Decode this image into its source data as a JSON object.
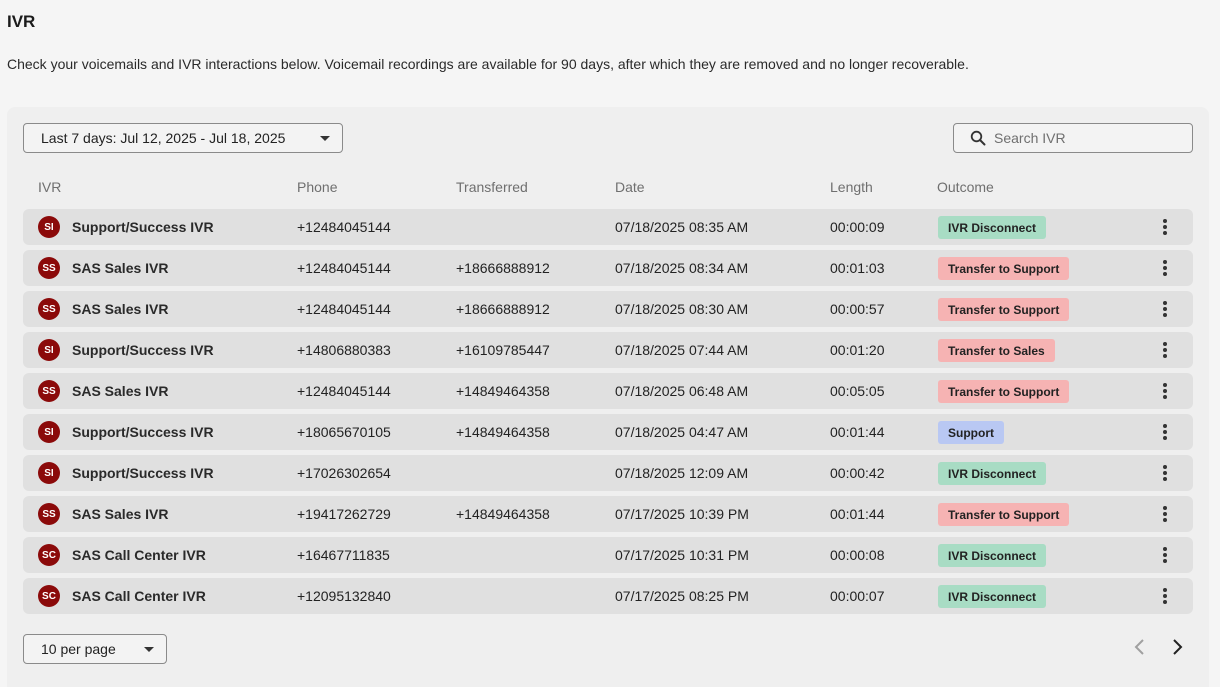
{
  "page": {
    "title": "IVR",
    "description": "Check your voicemails and IVR interactions below. Voicemail recordings are available for 90 days, after which they are removed and no longer recoverable."
  },
  "filters": {
    "date_range": "Last 7 days: Jul 12, 2025 - Jul 18, 2025",
    "search_placeholder": "Search IVR"
  },
  "columns": {
    "ivr": "IVR",
    "phone": "Phone",
    "transferred": "Transferred",
    "date": "Date",
    "length": "Length",
    "outcome": "Outcome"
  },
  "colors": {
    "avatar": "#8b0a0a",
    "ivr_disconnect": "#a8dcc4",
    "transfer": "#f6b3b3",
    "support": "#b9c8f3"
  },
  "rows": [
    {
      "initials": "SI",
      "ivr": "Support/Success IVR",
      "phone": "+12484045144",
      "transferred": "",
      "date": "07/18/2025 08:35 AM",
      "length": "00:00:09",
      "outcome": "IVR Disconnect",
      "outcome_color": "#a8dcc4"
    },
    {
      "initials": "SS",
      "ivr": "SAS Sales IVR",
      "phone": "+12484045144",
      "transferred": "+18666888912",
      "date": "07/18/2025 08:34 AM",
      "length": "00:01:03",
      "outcome": "Transfer to Support",
      "outcome_color": "#f6b3b3"
    },
    {
      "initials": "SS",
      "ivr": "SAS Sales IVR",
      "phone": "+12484045144",
      "transferred": "+18666888912",
      "date": "07/18/2025 08:30 AM",
      "length": "00:00:57",
      "outcome": "Transfer to Support",
      "outcome_color": "#f6b3b3"
    },
    {
      "initials": "SI",
      "ivr": "Support/Success IVR",
      "phone": "+14806880383",
      "transferred": "+16109785447",
      "date": "07/18/2025 07:44 AM",
      "length": "00:01:20",
      "outcome": "Transfer to Sales",
      "outcome_color": "#f6b3b3"
    },
    {
      "initials": "SS",
      "ivr": "SAS Sales IVR",
      "phone": "+12484045144",
      "transferred": "+14849464358",
      "date": "07/18/2025 06:48 AM",
      "length": "00:05:05",
      "outcome": "Transfer to Support",
      "outcome_color": "#f6b3b3"
    },
    {
      "initials": "SI",
      "ivr": "Support/Success IVR",
      "phone": "+18065670105",
      "transferred": "+14849464358",
      "date": "07/18/2025 04:47 AM",
      "length": "00:01:44",
      "outcome": "Support",
      "outcome_color": "#b9c8f3"
    },
    {
      "initials": "SI",
      "ivr": "Support/Success IVR",
      "phone": "+17026302654",
      "transferred": "",
      "date": "07/18/2025 12:09 AM",
      "length": "00:00:42",
      "outcome": "IVR Disconnect",
      "outcome_color": "#a8dcc4"
    },
    {
      "initials": "SS",
      "ivr": "SAS Sales IVR",
      "phone": "+19417262729",
      "transferred": "+14849464358",
      "date": "07/17/2025 10:39 PM",
      "length": "00:01:44",
      "outcome": "Transfer to Support",
      "outcome_color": "#f6b3b3"
    },
    {
      "initials": "SC",
      "ivr": "SAS Call Center IVR",
      "phone": "+16467711835",
      "transferred": "",
      "date": "07/17/2025 10:31 PM",
      "length": "00:00:08",
      "outcome": "IVR Disconnect",
      "outcome_color": "#a8dcc4"
    },
    {
      "initials": "SC",
      "ivr": "SAS Call Center IVR",
      "phone": "+12095132840",
      "transferred": "",
      "date": "07/17/2025 08:25 PM",
      "length": "00:00:07",
      "outcome": "IVR Disconnect",
      "outcome_color": "#a8dcc4"
    }
  ],
  "pagination": {
    "per_page": "10 per page"
  },
  "icons": {
    "search": "search-icon",
    "dropdown": "caret-down-icon",
    "row_menu": "kebab-menu-icon",
    "prev": "chevron-left-icon",
    "next": "chevron-right-icon"
  }
}
